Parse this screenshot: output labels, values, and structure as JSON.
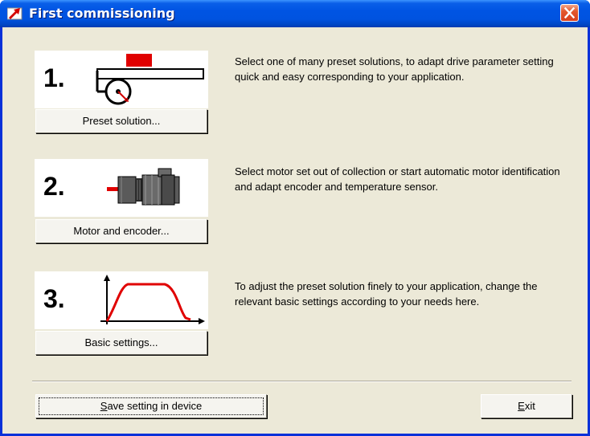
{
  "window": {
    "title": "First commissioning",
    "close_glyph": "✕",
    "colors": {
      "titlebar": "#0054e3",
      "face": "#ece9d8",
      "close": "#e2572c",
      "accent_red": "#e00000"
    }
  },
  "steps": [
    {
      "number": "1.",
      "icon": "slide-carriage-icon",
      "button_label": "Preset solution...",
      "description": "Select one of many preset solutions, to adapt drive parameter setting quick and easy corresponding to your application."
    },
    {
      "number": "2.",
      "icon": "servo-motor-icon",
      "button_label": "Motor and encoder...",
      "description": "Select motor set out of collection or start automatic motor identification and adapt encoder and temperature sensor."
    },
    {
      "number": "3.",
      "icon": "motion-profile-icon",
      "button_label": "Basic settings...",
      "description": "To adjust the preset solution finely to your application, change the relevant basic settings according to your needs here."
    }
  ],
  "footer": {
    "save_label_mnemonic": "S",
    "save_label_rest": "ave setting in device",
    "exit_label_mnemonic": "E",
    "exit_label_rest": "xit"
  }
}
